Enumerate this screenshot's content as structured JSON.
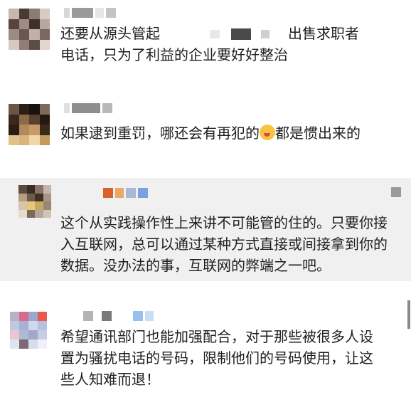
{
  "comments": [
    {
      "text_before": "还要从源头管起",
      "text_mid": "出售求职者",
      "line2": "电话，只为了利益的企业要好好整治"
    },
    {
      "text_before": "如果逮到重罚，哪还会有再犯的",
      "emoji": "drooling-face-icon",
      "text_after": "都是惯出来的"
    },
    {
      "line1": "这个从实践操作性上来讲不可能管的住的。只要你接",
      "line2": "入互联网，总可以通过某种方式直接或间接拿到你的",
      "line3": "数据。没办法的事，互联网的弊端之一吧。"
    },
    {
      "line1": "希望通讯部门也能加强配合，对于那些被很多人设",
      "line2": "置为骚扰电话的号码，限制他们的号码使用，让这",
      "line3": "些人知难而退！"
    }
  ],
  "colors": {
    "gray_row": "#f0f0f0",
    "text": "#1e1e1e"
  }
}
